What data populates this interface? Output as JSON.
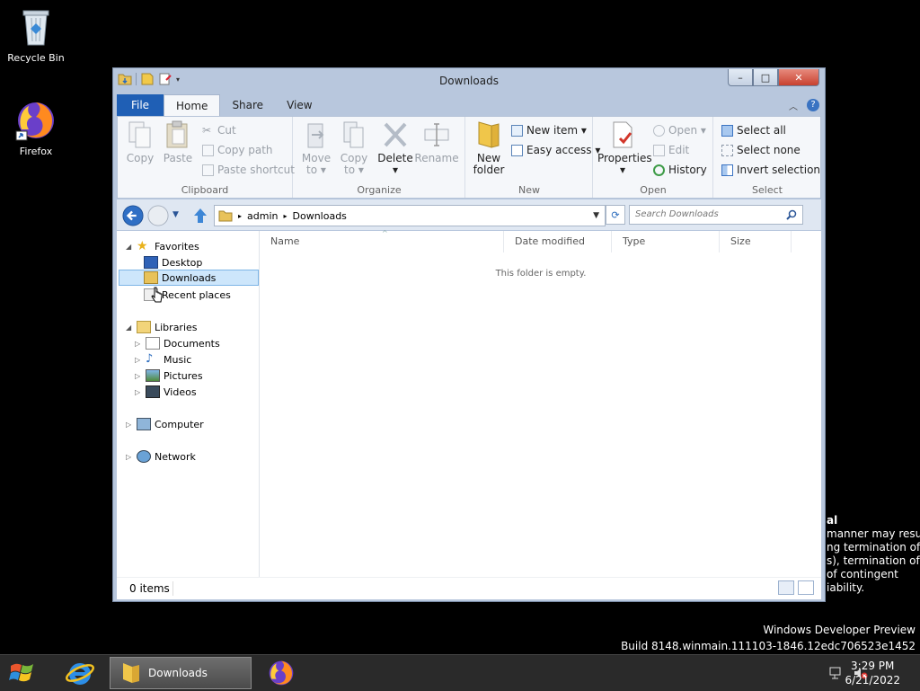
{
  "desktop": {
    "icons": [
      {
        "label": "Recycle Bin",
        "icon": "recycle-bin-icon"
      },
      {
        "label": "Firefox",
        "icon": "firefox-icon"
      }
    ],
    "background_text": [
      "al",
      "manner may result",
      "ng termination of",
      "s), termination of",
      "of contingent",
      "iability."
    ],
    "watermark": {
      "line1": "Windows Developer Preview",
      "line2": "Build 8148.winmain.111103-1846.12edc706523e1452"
    }
  },
  "window": {
    "title": "Downloads",
    "buttons": {
      "minimize": "–",
      "maximize": "□",
      "close": "✕"
    },
    "ribbon_tabs": [
      "File",
      "Home",
      "Share",
      "View"
    ],
    "active_tab": "Home",
    "help": "?",
    "groups": {
      "clipboard": {
        "label": "Clipboard",
        "copy": "Copy",
        "paste": "Paste",
        "cut": "Cut",
        "copy_path": "Copy path",
        "paste_shortcut": "Paste shortcut"
      },
      "organize": {
        "label": "Organize",
        "move_to": "Move",
        "move_to_2": "to ▾",
        "copy_to": "Copy",
        "copy_to_2": "to ▾",
        "delete": "Delete",
        "delete_2": "▾",
        "rename": "Rename"
      },
      "new": {
        "label": "New",
        "new_folder": "New",
        "new_folder_2": "folder",
        "new_item": "New item ▾",
        "easy_access": "Easy access ▾"
      },
      "open": {
        "label": "Open",
        "properties": "Properties",
        "properties_2": "▾",
        "open": "Open ▾",
        "edit": "Edit",
        "history": "History"
      },
      "select": {
        "label": "Select",
        "select_all": "Select all",
        "select_none": "Select none",
        "invert": "Invert selection"
      }
    },
    "address": {
      "crumbs": [
        "admin",
        "Downloads"
      ]
    },
    "search": {
      "placeholder": "Search Downloads"
    },
    "nav_tree": {
      "favorites": "Favorites",
      "desktop": "Desktop",
      "downloads": "Downloads",
      "recent": "Recent places",
      "libraries": "Libraries",
      "documents": "Documents",
      "music": "Music",
      "pictures": "Pictures",
      "videos": "Videos",
      "computer": "Computer",
      "network": "Network"
    },
    "columns": [
      "Name",
      "Date modified",
      "Type",
      "Size"
    ],
    "empty_message": "This folder is empty.",
    "status": {
      "count": "0 items"
    }
  },
  "taskbar": {
    "active_task": "Downloads",
    "time": "3:29 PM",
    "date": "6/21/2022"
  },
  "colors": {
    "accent": "#1f5fb5",
    "selection": "#cde6fb",
    "taskbar": "#2a2a2a"
  }
}
